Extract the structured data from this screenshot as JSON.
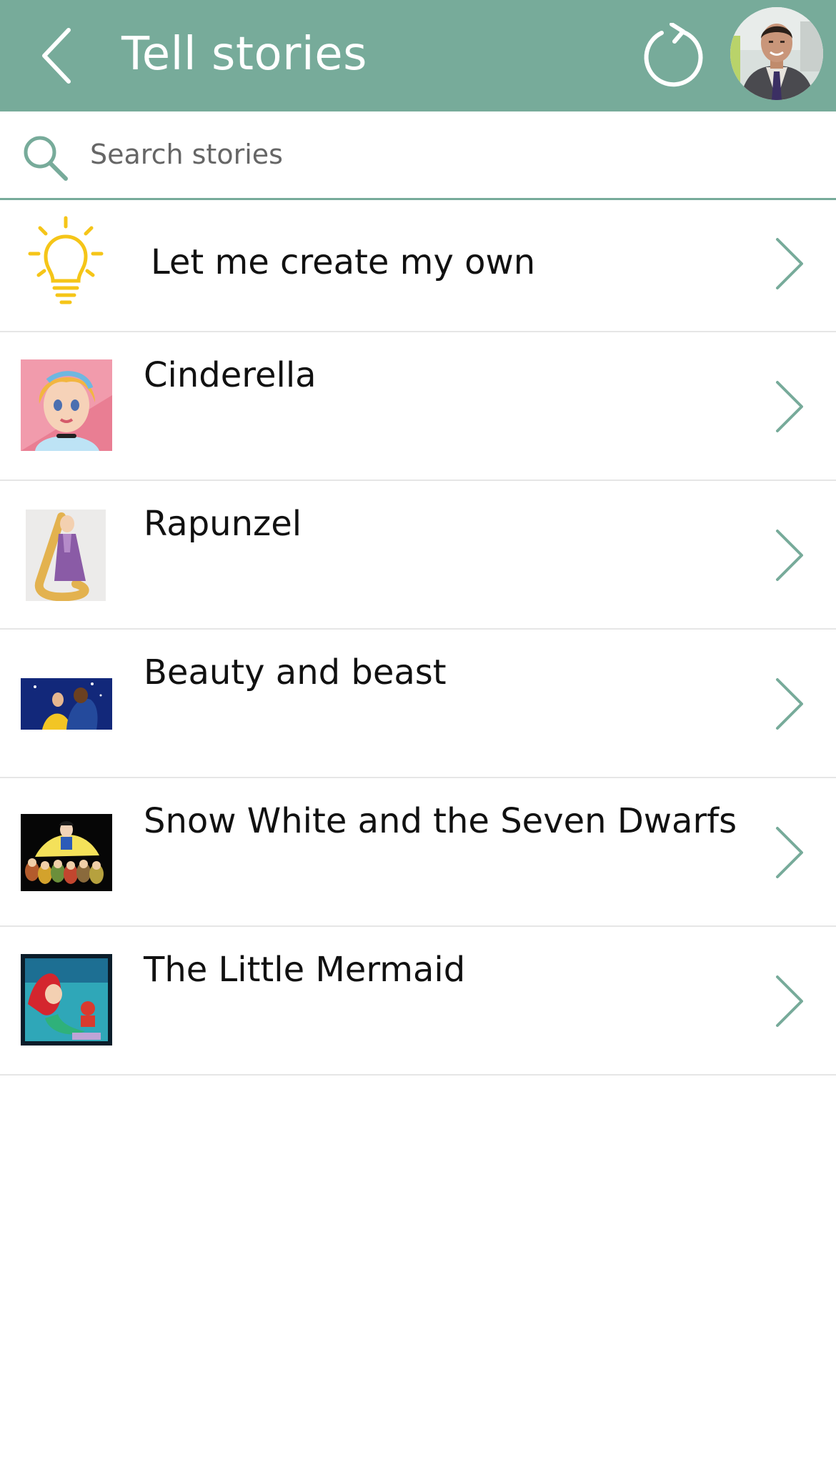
{
  "header": {
    "title": "Tell stories",
    "back_icon": "chevron-left-icon",
    "refresh_icon": "refresh-icon",
    "avatar_icon": "user-avatar",
    "background_color": "#77ab9a"
  },
  "search": {
    "placeholder": "Search stories",
    "value": "",
    "icon": "search-icon"
  },
  "create_row": {
    "label": "Let me create my own",
    "icon": "lightbulb-icon",
    "icon_color": "#f5c518"
  },
  "stories": [
    {
      "title": "Cinderella"
    },
    {
      "title": "Rapunzel"
    },
    {
      "title": "Beauty and beast"
    },
    {
      "title": "Snow White and the Seven Dwarfs"
    },
    {
      "title": "The Little Mermaid"
    }
  ],
  "colors": {
    "accent": "#77ab9a",
    "chevron": "#77ab9a",
    "divider": "#e6e6e6"
  }
}
